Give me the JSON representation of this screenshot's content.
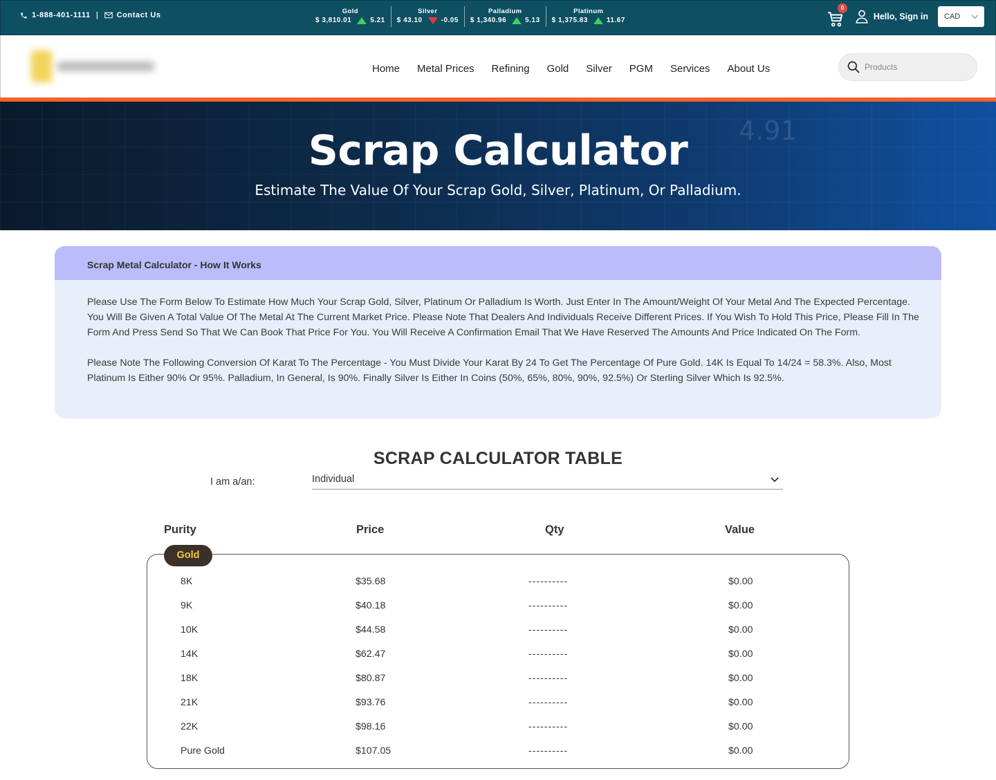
{
  "topbar": {
    "phone": "1-888-401-1111",
    "contact": "Contact Us",
    "tickers": [
      {
        "name": "Gold",
        "price": "$ 3,810.01",
        "change": "5.21",
        "direction": "up"
      },
      {
        "name": "Silver",
        "price": "$ 43.10",
        "change": "-0.05",
        "direction": "down"
      },
      {
        "name": "Palladium",
        "price": "$ 1,340.96",
        "change": "5.13",
        "direction": "up"
      },
      {
        "name": "Platinum",
        "price": "$ 1,375.83",
        "change": "11.67",
        "direction": "up"
      }
    ],
    "cart_count": "0",
    "signin": "Hello, Sign in",
    "currency": "CAD"
  },
  "nav": {
    "items": [
      "Home",
      "Metal Prices",
      "Refining",
      "Gold",
      "Silver",
      "PGM",
      "Services",
      "About Us"
    ],
    "search_placeholder": "Products"
  },
  "hero": {
    "title": "Scrap Calculator",
    "subtitle": "Estimate The Value Of Your Scrap Gold, Silver, Platinum, Or Palladium."
  },
  "info": {
    "heading": "Scrap Metal Calculator - How It Works",
    "p1": "Please Use The Form Below To Estimate How Much Your Scrap Gold, Silver, Platinum Or Palladium Is Worth. Just Enter In The Amount/Weight Of Your Metal And The Expected Percentage. You Will Be Given A Total Value Of The Metal At The Current Market Price. Please Note That Dealers And Individuals Receive Different Prices. If You Wish To Hold This Price, Please Fill In The Form And Press Send So That We Can Book That Price For You. You Will Receive A Confirmation Email That We Have Reserved The Amounts And Price Indicated On The Form.",
    "p2": "Please Note The Following Conversion Of Karat To The Percentage - You Must Divide Your Karat By 24 To Get The Percentage Of Pure Gold. 14K Is Equal To 14/24 = 58.3%. Also, Most Platinum Is Either 90% Or 95%. Palladium, In General, Is 90%. Finally Silver Is Either In Coins (50%, 65%, 80%, 90%, 92.5%) Or Sterling Silver Which Is 92.5%."
  },
  "calculator": {
    "title": "SCRAP CALCULATOR TABLE",
    "iam_label": "I am a/an:",
    "iam_value": "Individual",
    "headers": {
      "purity": "Purity",
      "price": "Price",
      "qty": "Qty",
      "value": "Value"
    },
    "group": "Gold",
    "rows": [
      {
        "purity": "8K",
        "price": "$35.68",
        "qty": "----------",
        "value": "$0.00"
      },
      {
        "purity": "9K",
        "price": "$40.18",
        "qty": "----------",
        "value": "$0.00"
      },
      {
        "purity": "10K",
        "price": "$44.58",
        "qty": "----------",
        "value": "$0.00"
      },
      {
        "purity": "14K",
        "price": "$62.47",
        "qty": "----------",
        "value": "$0.00"
      },
      {
        "purity": "18K",
        "price": "$80.87",
        "qty": "----------",
        "value": "$0.00"
      },
      {
        "purity": "21K",
        "price": "$93.76",
        "qty": "----------",
        "value": "$0.00"
      },
      {
        "purity": "22K",
        "price": "$98.16",
        "qty": "----------",
        "value": "$0.00"
      },
      {
        "purity": "Pure Gold",
        "price": "$107.05",
        "qty": "----------",
        "value": "$0.00"
      }
    ]
  }
}
